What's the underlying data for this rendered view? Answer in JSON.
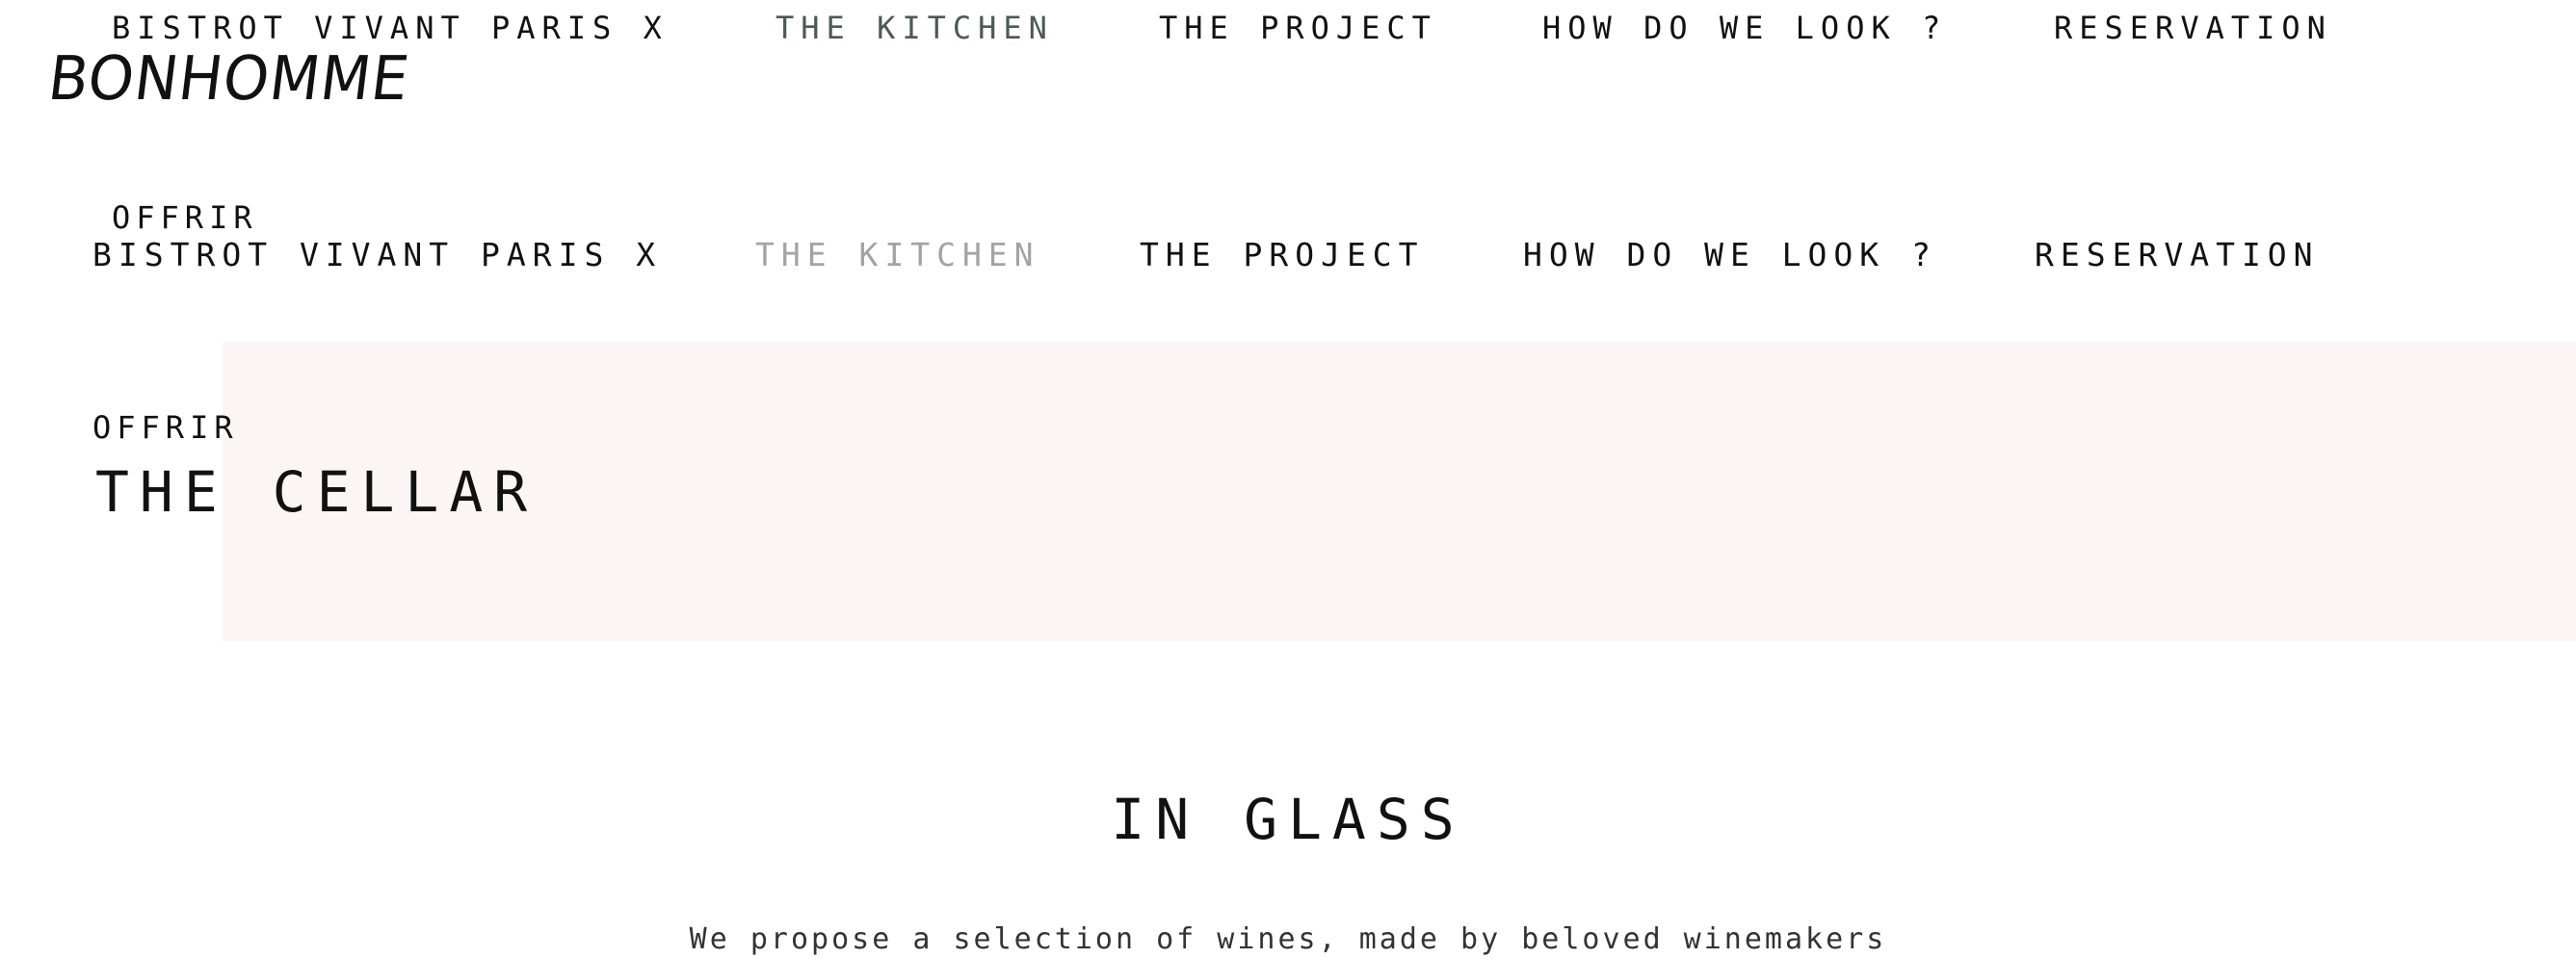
{
  "top_nav": {
    "items": [
      {
        "label": "BISTROT VIVANT PARIS X"
      },
      {
        "label": "THE KITCHEN"
      },
      {
        "label": "THE PROJECT"
      },
      {
        "label": "HOW DO WE LOOK ?"
      },
      {
        "label": "RESERVATION"
      }
    ],
    "active_item": "THE KITCHEN",
    "offrir_label": "OFFRIR"
  },
  "brand": {
    "logo_text": "BONHOMME"
  },
  "secondary_nav": {
    "items": [
      {
        "label": "BISTROT VIVANT PARIS X"
      },
      {
        "label": "THE KITCHEN"
      },
      {
        "label": "THE PROJECT"
      },
      {
        "label": "HOW DO WE LOOK ?"
      },
      {
        "label": "RESERVATION"
      }
    ],
    "active_item": "THE KITCHEN",
    "offrir_label": "OFFRIR"
  },
  "hero": {
    "title": "THE CELLAR"
  },
  "section": {
    "title": "IN GLASS",
    "text": "We propose a selection of wines, made by beloved winemakers"
  },
  "colors": {
    "text": "#111111",
    "top_active": "#4a5a55",
    "secondary_active": "#a3a3a3",
    "hero_band": "#fbf6f5"
  }
}
